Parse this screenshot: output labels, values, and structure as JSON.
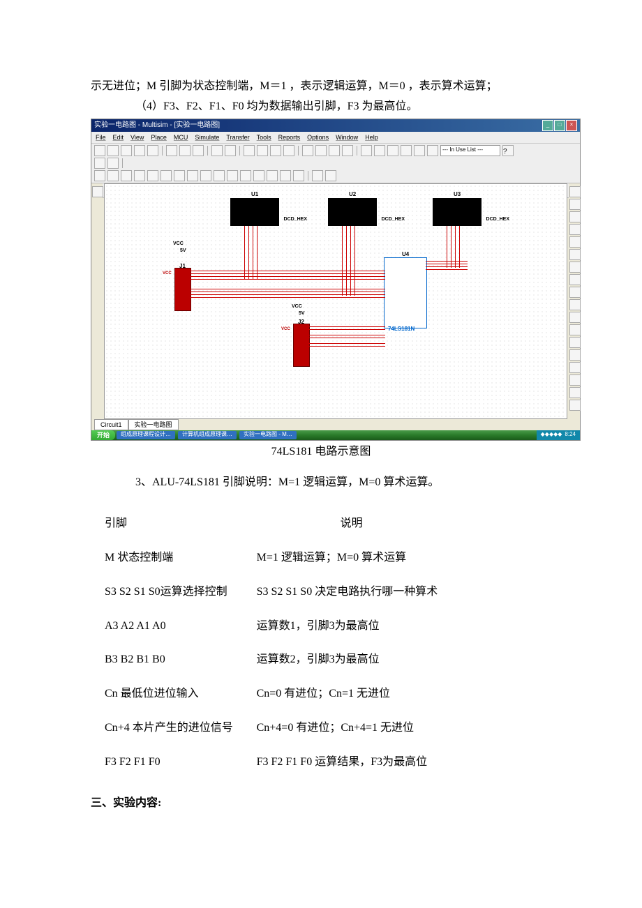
{
  "top_text": {
    "line1": "示无进位；M 引脚为状态控制端，M＝1 ，表示逻辑运算，M＝0 ，表示算术运算；",
    "line4": "（4）F3、F2、F1、F0 均为数据输出引脚，F3 为最高位。"
  },
  "multisim": {
    "title": "实验一电路图 - Multisim - [实验一电路图]",
    "menu": [
      "File",
      "Edit",
      "View",
      "Place",
      "MCU",
      "Simulate",
      "Transfer",
      "Tools",
      "Reports",
      "Options",
      "Window",
      "Help"
    ],
    "use_list": "--- In Use List ---",
    "components": {
      "u1": "U1",
      "u2": "U2",
      "u3": "U3",
      "u4": "U4",
      "dcd": "DCD_HEX",
      "vcc": "VCC",
      "v5": "5V",
      "j1": "J1",
      "j2": "J2",
      "ic": "74LS181N"
    },
    "tabs": {
      "t1": "Circuit1",
      "t2": "实验一电路图"
    },
    "taskbar": {
      "start": "开始",
      "items": [
        "组成原理课程设计…",
        "计算机组成原理课…",
        "实验一电路图 - M…"
      ],
      "time": "8:24"
    }
  },
  "caption": "74LS181 电路示意图",
  "section3_intro": "3、ALU-74LS181 引脚说明：M=1 逻辑运算，M=0 算术运算。",
  "table": {
    "header": {
      "pin": "引脚",
      "desc": "说明"
    },
    "rows": [
      {
        "pin": "M 状态控制端",
        "desc": "M=1 逻辑运算；M=0 算术运算"
      },
      {
        "pin": "S3 S2 S1 S0运算选择控制",
        "desc": "S3 S2 S1 S0 决定电路执行哪一种算术"
      },
      {
        "pin": "A3 A2 A1 A0",
        "desc": "运算数1，引脚3为最高位"
      },
      {
        "pin": "B3 B2 B1 B0",
        "desc": "运算数2，引脚3为最高位"
      },
      {
        "pin": "Cn 最低位进位输入",
        "desc": "Cn=0 有进位；Cn=1 无进位"
      },
      {
        "pin": "Cn+4 本片产生的进位信号",
        "desc": "Cn+4=0 有进位；Cn+4=1 无进位"
      },
      {
        "pin": "F3 F2 F1 F0",
        "desc": "F3 F2 F1 F0 运算结果，F3为最高位"
      }
    ]
  },
  "section_title": "三、实验内容:"
}
